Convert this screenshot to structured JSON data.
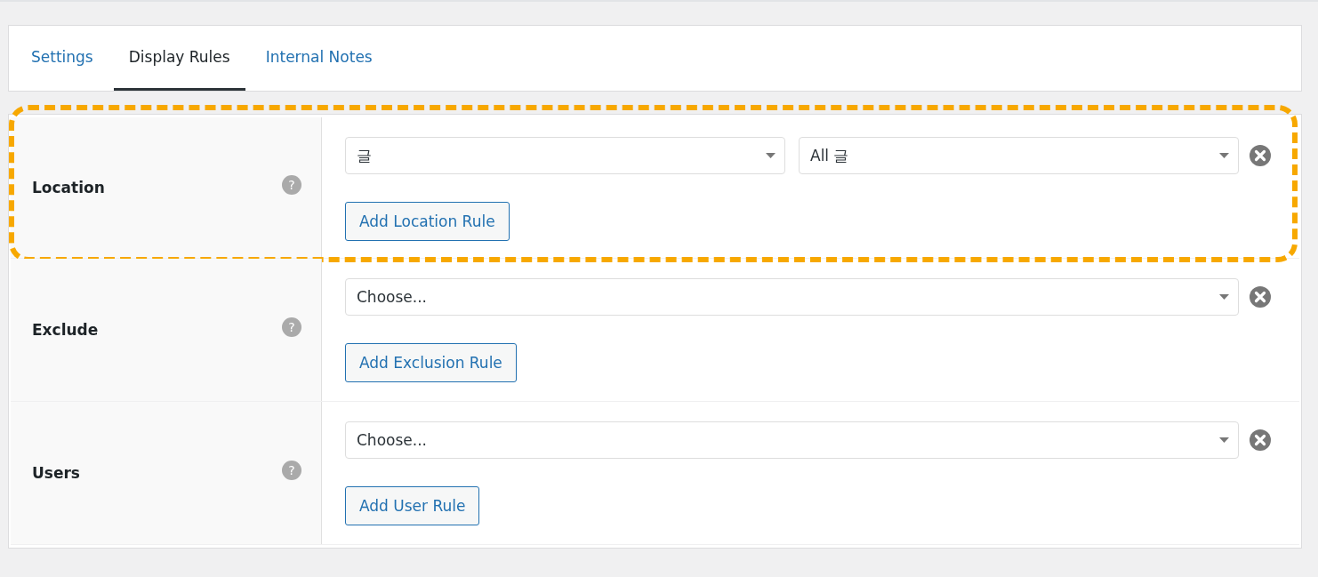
{
  "tabs": [
    {
      "label": "Settings",
      "selected": false
    },
    {
      "label": "Display Rules",
      "selected": true
    },
    {
      "label": "Internal Notes",
      "selected": false
    }
  ],
  "rules": [
    {
      "label": "Location",
      "help": "?",
      "selects": [
        "글",
        "All 글"
      ],
      "button": "Add Location Rule",
      "highlighted": true
    },
    {
      "label": "Exclude",
      "help": "?",
      "selects": [
        "Choose..."
      ],
      "button": "Add Exclusion Rule",
      "highlighted": false
    },
    {
      "label": "Users",
      "help": "?",
      "selects": [
        "Choose..."
      ],
      "button": "Add User Rule",
      "highlighted": false
    }
  ]
}
